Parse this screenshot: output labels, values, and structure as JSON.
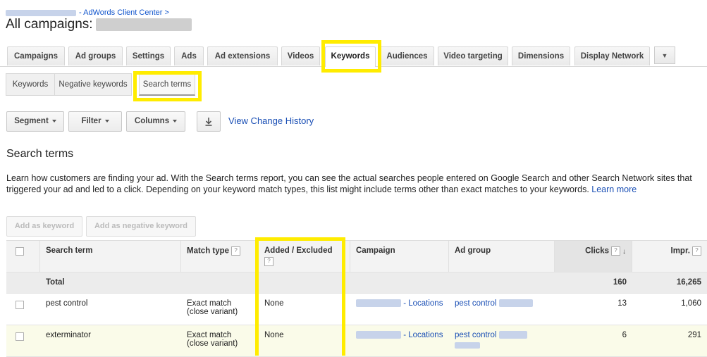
{
  "breadcrumb": {
    "link": "- AdWords Client Center >"
  },
  "page_title": "All campaigns:",
  "tabs": [
    "Campaigns",
    "Ad groups",
    "Settings",
    "Ads",
    "Ad extensions",
    "Videos",
    "Keywords",
    "Audiences",
    "Video targeting",
    "Dimensions",
    "Display Network"
  ],
  "tab_more": "▼",
  "subtabs": [
    "Keywords",
    "Negative keywords",
    "Search terms"
  ],
  "toolbar": {
    "segment": "Segment",
    "filter": "Filter",
    "columns": "Columns",
    "download_icon": "download-icon",
    "change_history": "View Change History"
  },
  "section": {
    "title": "Search terms",
    "description": "Learn how customers are finding your ad. With the Search terms report, you can see the actual searches people entered on Google Search and other Search Network sites that triggered your ad and led to a click. Depending on your keyword match types, this list might include terms other than exact matches to your keywords.",
    "learn_more": "Learn more"
  },
  "actions": {
    "add_keyword": "Add as keyword",
    "add_negative": "Add as negative keyword"
  },
  "table": {
    "headers": {
      "search_term": "Search term",
      "match_type": "Match type",
      "added_excluded": "Added / Excluded",
      "campaign": "Campaign",
      "ad_group": "Ad group",
      "clicks": "Clicks",
      "impr": "Impr."
    },
    "help_glyph": "?",
    "sort_glyph": "↓",
    "total": {
      "label": "Total",
      "clicks": "160",
      "impr": "16,265"
    },
    "rows": [
      {
        "search_term": "pest control",
        "match_line1": "Exact match",
        "match_line2": "(close variant)",
        "added": "None",
        "campaign": "- Locations",
        "ad_group": "pest control",
        "clicks": "13",
        "impr": "1,060"
      },
      {
        "search_term": "exterminator",
        "match_line1": "Exact match",
        "match_line2": "(close variant)",
        "added": "None",
        "campaign": "- Locations",
        "ad_group": "pest control",
        "clicks": "6",
        "impr": "291"
      }
    ]
  },
  "colors": {
    "highlight": "#ffec00",
    "link": "#1a4fb5",
    "selected_row": "#fafbe9"
  }
}
